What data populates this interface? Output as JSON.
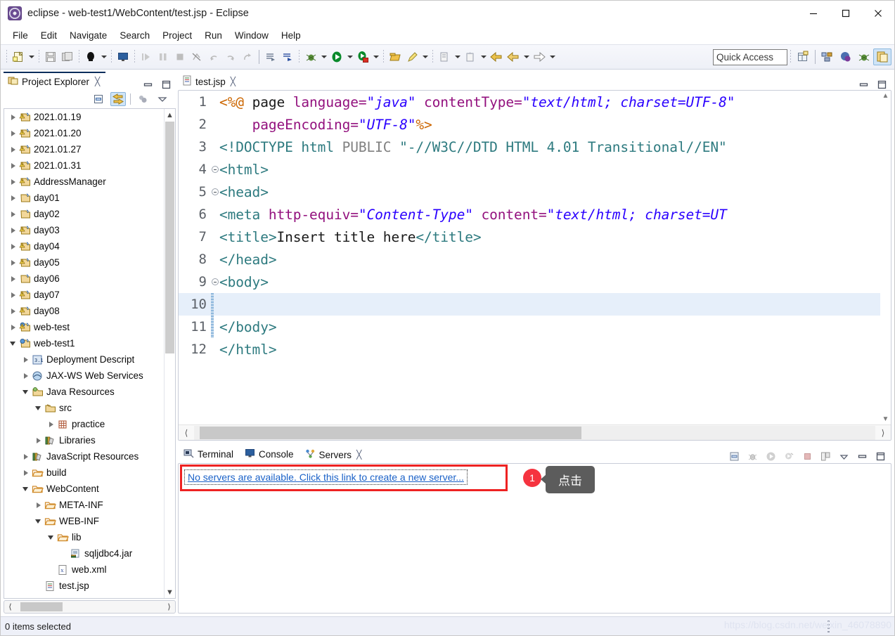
{
  "window": {
    "title": "eclipse - web-test1/WebContent/test.jsp - Eclipse",
    "icon": "eclipse-icon",
    "controls": {
      "minimize": "minimize-icon",
      "maximize": "maximize-icon",
      "close": "close-icon"
    }
  },
  "menubar": {
    "items": [
      "File",
      "Edit",
      "Navigate",
      "Search",
      "Project",
      "Run",
      "Window",
      "Help"
    ]
  },
  "toolbar": {
    "quick_access_placeholder": "Quick Access",
    "buttons": [
      "new-wizard-icon",
      "save-icon",
      "save-all-icon",
      "print-icon",
      "open-console-icon",
      "step-into-icon",
      "step-over-icon",
      "terminate-icon",
      "skip-breakpoints-icon",
      "next-annotation-icon",
      "previous-annotation-icon",
      "last-edit-icon",
      "build-icon",
      "publish-icon",
      "debug-icon",
      "run-icon",
      "run-server-icon",
      "open-type-icon",
      "open-task-icon",
      "new-java-package-icon",
      "new-class-icon",
      "back-icon",
      "forward-icon",
      "next-icon"
    ],
    "perspective_buttons": [
      "open-perspective-icon",
      "java-ee-perspective-icon",
      "web-perspective-icon",
      "debug-perspective-icon",
      "java-perspective-icon"
    ]
  },
  "explorer": {
    "tab_label": "Project Explorer",
    "tab_icon": "project-explorer-icon",
    "close_icon": "close-tab-icon",
    "minimize_icon": "minimize-view-icon",
    "maximize_icon": "maximize-view-icon",
    "toolbar": [
      "collapse-all-icon",
      "link-with-editor-icon",
      "view-menu-icon",
      "view-dropdown-icon"
    ],
    "tree": [
      {
        "label": "2021.01.19",
        "indent": 0,
        "state": "collapsed",
        "icon": "java-project-warning-icon"
      },
      {
        "label": "2021.01.20",
        "indent": 0,
        "state": "collapsed",
        "icon": "java-project-warning-icon"
      },
      {
        "label": "2021.01.27",
        "indent": 0,
        "state": "collapsed",
        "icon": "java-project-warning-icon"
      },
      {
        "label": "2021.01.31",
        "indent": 0,
        "state": "collapsed",
        "icon": "java-project-warning-icon"
      },
      {
        "label": "AddressManager",
        "indent": 0,
        "state": "collapsed",
        "icon": "java-project-warning-icon"
      },
      {
        "label": "day01",
        "indent": 0,
        "state": "collapsed",
        "icon": "java-project-icon"
      },
      {
        "label": "day02",
        "indent": 0,
        "state": "collapsed",
        "icon": "java-project-icon"
      },
      {
        "label": "day03",
        "indent": 0,
        "state": "collapsed",
        "icon": "java-project-warning-icon"
      },
      {
        "label": "day04",
        "indent": 0,
        "state": "collapsed",
        "icon": "java-project-warning-icon"
      },
      {
        "label": "day05",
        "indent": 0,
        "state": "collapsed",
        "icon": "java-project-warning-icon"
      },
      {
        "label": "day06",
        "indent": 0,
        "state": "collapsed",
        "icon": "java-project-icon"
      },
      {
        "label": "day07",
        "indent": 0,
        "state": "collapsed",
        "icon": "java-project-warning-icon"
      },
      {
        "label": "day08",
        "indent": 0,
        "state": "collapsed",
        "icon": "java-project-warning-icon"
      },
      {
        "label": "web-test",
        "indent": 0,
        "state": "collapsed",
        "icon": "web-project-warning-icon"
      },
      {
        "label": "web-test1",
        "indent": 0,
        "state": "expanded",
        "icon": "web-project-icon"
      },
      {
        "label": "Deployment Descript",
        "indent": 1,
        "state": "collapsed",
        "icon": "deployment-descriptor-icon"
      },
      {
        "label": "JAX-WS Web Services",
        "indent": 1,
        "state": "collapsed",
        "icon": "jaxws-icon"
      },
      {
        "label": "Java Resources",
        "indent": 1,
        "state": "expanded",
        "icon": "java-resources-icon"
      },
      {
        "label": "src",
        "indent": 2,
        "state": "expanded",
        "icon": "source-folder-icon"
      },
      {
        "label": "practice",
        "indent": 3,
        "state": "collapsed",
        "icon": "package-icon"
      },
      {
        "label": "Libraries",
        "indent": 2,
        "state": "collapsed",
        "icon": "libraries-icon"
      },
      {
        "label": "JavaScript Resources",
        "indent": 1,
        "state": "collapsed",
        "icon": "libraries-icon"
      },
      {
        "label": "build",
        "indent": 1,
        "state": "collapsed",
        "icon": "folder-icon"
      },
      {
        "label": "WebContent",
        "indent": 1,
        "state": "expanded",
        "icon": "folder-icon"
      },
      {
        "label": "META-INF",
        "indent": 2,
        "state": "collapsed",
        "icon": "folder-icon"
      },
      {
        "label": "WEB-INF",
        "indent": 2,
        "state": "expanded",
        "icon": "folder-icon"
      },
      {
        "label": "lib",
        "indent": 3,
        "state": "expanded",
        "icon": "folder-icon"
      },
      {
        "label": "sqljdbc4.jar",
        "indent": 4,
        "state": "leaf",
        "icon": "jar-icon"
      },
      {
        "label": "web.xml",
        "indent": 3,
        "state": "leaf",
        "icon": "xml-file-icon"
      },
      {
        "label": "test.jsp",
        "indent": 2,
        "state": "leaf",
        "icon": "jsp-file-icon"
      }
    ]
  },
  "editor": {
    "tab_label": "test.jsp",
    "tab_icon": "jsp-file-icon",
    "close_icon": "close-tab-icon",
    "minimize_icon": "minimize-view-icon",
    "maximize_icon": "maximize-view-icon",
    "current_line": 10,
    "lines": [
      {
        "num": 1,
        "fold": false,
        "tokens": [
          {
            "t": "<%@ ",
            "c": "k-jsp"
          },
          {
            "t": "page ",
            "c": "k-txt"
          },
          {
            "t": "language=",
            "c": "k-attr"
          },
          {
            "t": "\"java\"",
            "c": "k-val"
          },
          {
            "t": " ",
            "c": "k-txt"
          },
          {
            "t": "contentType=",
            "c": "k-attr"
          },
          {
            "t": "\"text/html; charset=UTF-8\"",
            "c": "k-val"
          }
        ]
      },
      {
        "num": 2,
        "fold": false,
        "tokens": [
          {
            "t": "    ",
            "c": "k-txt"
          },
          {
            "t": "pageEncoding=",
            "c": "k-attr"
          },
          {
            "t": "\"UTF-8\"",
            "c": "k-val"
          },
          {
            "t": "%>",
            "c": "k-jsp"
          }
        ]
      },
      {
        "num": 3,
        "fold": false,
        "tokens": [
          {
            "t": "<!DOCTYPE ",
            "c": "k-tag"
          },
          {
            "t": "html ",
            "c": "k-tag"
          },
          {
            "t": "PUBLIC ",
            "c": "k-doc"
          },
          {
            "t": "\"-//W3C//DTD HTML 4.01 Transitional//EN\"",
            "c": "k-tag"
          }
        ]
      },
      {
        "num": 4,
        "fold": true,
        "tokens": [
          {
            "t": "<html>",
            "c": "k-tag"
          }
        ]
      },
      {
        "num": 5,
        "fold": true,
        "tokens": [
          {
            "t": "<head>",
            "c": "k-tag"
          }
        ]
      },
      {
        "num": 6,
        "fold": false,
        "tokens": [
          {
            "t": "<meta ",
            "c": "k-tag"
          },
          {
            "t": "http-equiv=",
            "c": "k-attr"
          },
          {
            "t": "\"Content-Type\"",
            "c": "k-val"
          },
          {
            "t": " ",
            "c": "k-txt"
          },
          {
            "t": "content=",
            "c": "k-attr"
          },
          {
            "t": "\"text/html; charset=UT",
            "c": "k-val"
          }
        ]
      },
      {
        "num": 7,
        "fold": false,
        "tokens": [
          {
            "t": "<title>",
            "c": "k-tag"
          },
          {
            "t": "Insert title here",
            "c": "k-txt"
          },
          {
            "t": "</title>",
            "c": "k-tag"
          }
        ]
      },
      {
        "num": 8,
        "fold": false,
        "tokens": [
          {
            "t": "</head>",
            "c": "k-tag"
          }
        ]
      },
      {
        "num": 9,
        "fold": true,
        "tokens": [
          {
            "t": "<body>",
            "c": "k-tag"
          }
        ]
      },
      {
        "num": 10,
        "fold": false,
        "tokens": [
          {
            "t": "",
            "c": "k-txt"
          }
        ]
      },
      {
        "num": 11,
        "fold": false,
        "tokens": [
          {
            "t": "</body>",
            "c": "k-tag"
          }
        ]
      },
      {
        "num": 12,
        "fold": false,
        "tokens": [
          {
            "t": "</html>",
            "c": "k-tag"
          }
        ]
      }
    ]
  },
  "bottom_panel": {
    "tabs": [
      {
        "label": "Terminal",
        "icon": "terminal-icon",
        "active": false,
        "closable": false
      },
      {
        "label": "Console",
        "icon": "console-icon",
        "active": false,
        "closable": false
      },
      {
        "label": "Servers",
        "icon": "servers-icon",
        "active": true,
        "closable": true
      }
    ],
    "close_icon": "close-tab-icon",
    "toolbar": [
      "clear-icon",
      "debug-server-icon",
      "start-server-icon",
      "profile-server-icon",
      "stop-server-icon",
      "publish-server-icon",
      "view-menu-icon",
      "minimize-view-icon",
      "maximize-view-icon"
    ],
    "server_link": "No servers are available. Click this link to create a new server..."
  },
  "annotation": {
    "badge": "1",
    "tooltip": "点击",
    "highlight_color": "#ee2222",
    "badge_color": "#f5333f",
    "tooltip_bg": "#5c5c5c"
  },
  "statusbar": {
    "text": "0 items selected",
    "watermark": "https://blog.csdn.net/weixin_46078890"
  }
}
